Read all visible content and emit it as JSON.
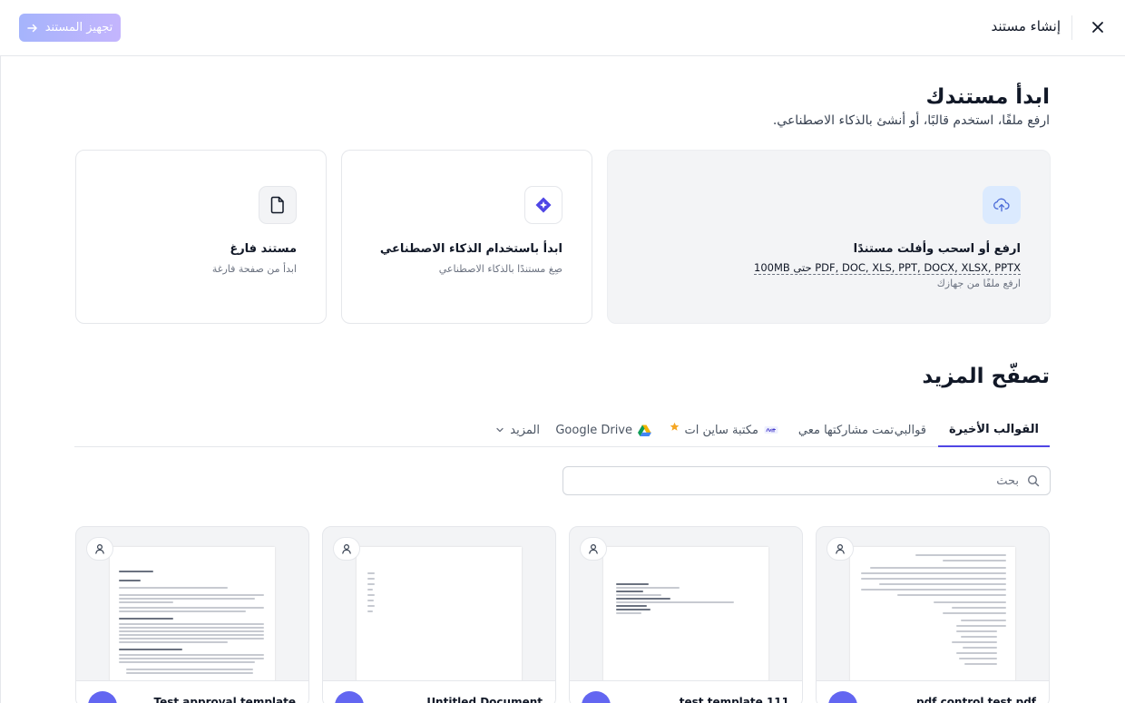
{
  "topbar": {
    "title": "إنشاء مستند",
    "prepare_label": "تجهيز المستند",
    "close_icon": "close-icon",
    "arrow_icon": "arrow-right-icon"
  },
  "start": {
    "title": "ابدأ مستندك",
    "subtitle": "ارفع ملفًا، استخدم قالبًا، أو أنشئ بالذكاء الاصطناعي."
  },
  "cards": {
    "upload": {
      "title": "ارفع أو اسحب وأفلت مستندًا",
      "formats": "PDF, DOC, XLS, PPT, DOCX, XLSX, PPTX حتى 100MB",
      "note": "ارفع ملفًا من جهازك",
      "icon": "cloud-upload-icon"
    },
    "ai": {
      "title": "ابدأ باستخدام الذكاء الاصطناعي",
      "desc": "صِغ مستندًا بالذكاء الاصطناعي",
      "icon": "ai-sparkle-icon"
    },
    "blank": {
      "title": "مستند فارغ",
      "desc": "ابدأ من صفحة فارغة",
      "icon": "document-icon"
    }
  },
  "browse": {
    "title": "تصفّح المزيد",
    "tabs": {
      "recent": "القوالب الأخيرة",
      "mine": "قوالبي",
      "shared": "تمت مشاركتها معي",
      "library": "مكتبة ساين ات",
      "gdrive": "Google Drive",
      "more": "المزيد"
    },
    "active_tab": "recent",
    "search_placeholder": "بحث"
  },
  "templates": [
    {
      "name": "pdf control test pdf",
      "owner_icon": "user-icon"
    },
    {
      "name": "test template 111",
      "owner_icon": "user-icon"
    },
    {
      "name": "Untitled Document",
      "owner_icon": "user-icon"
    },
    {
      "name": "Test approval template",
      "owner_icon": "user-icon"
    }
  ],
  "colors": {
    "accent": "#4f46e5",
    "prepare_btn_start": "#a5b4fc",
    "prepare_btn_end": "#c4b5fd",
    "upload_icon_bg": "#dbeafe",
    "ai_icon": "#4f46e5",
    "google_drive_green": "#0f9d58",
    "google_drive_yellow": "#f4b400",
    "google_drive_blue": "#4285f4",
    "library_star": "#f5a623"
  }
}
